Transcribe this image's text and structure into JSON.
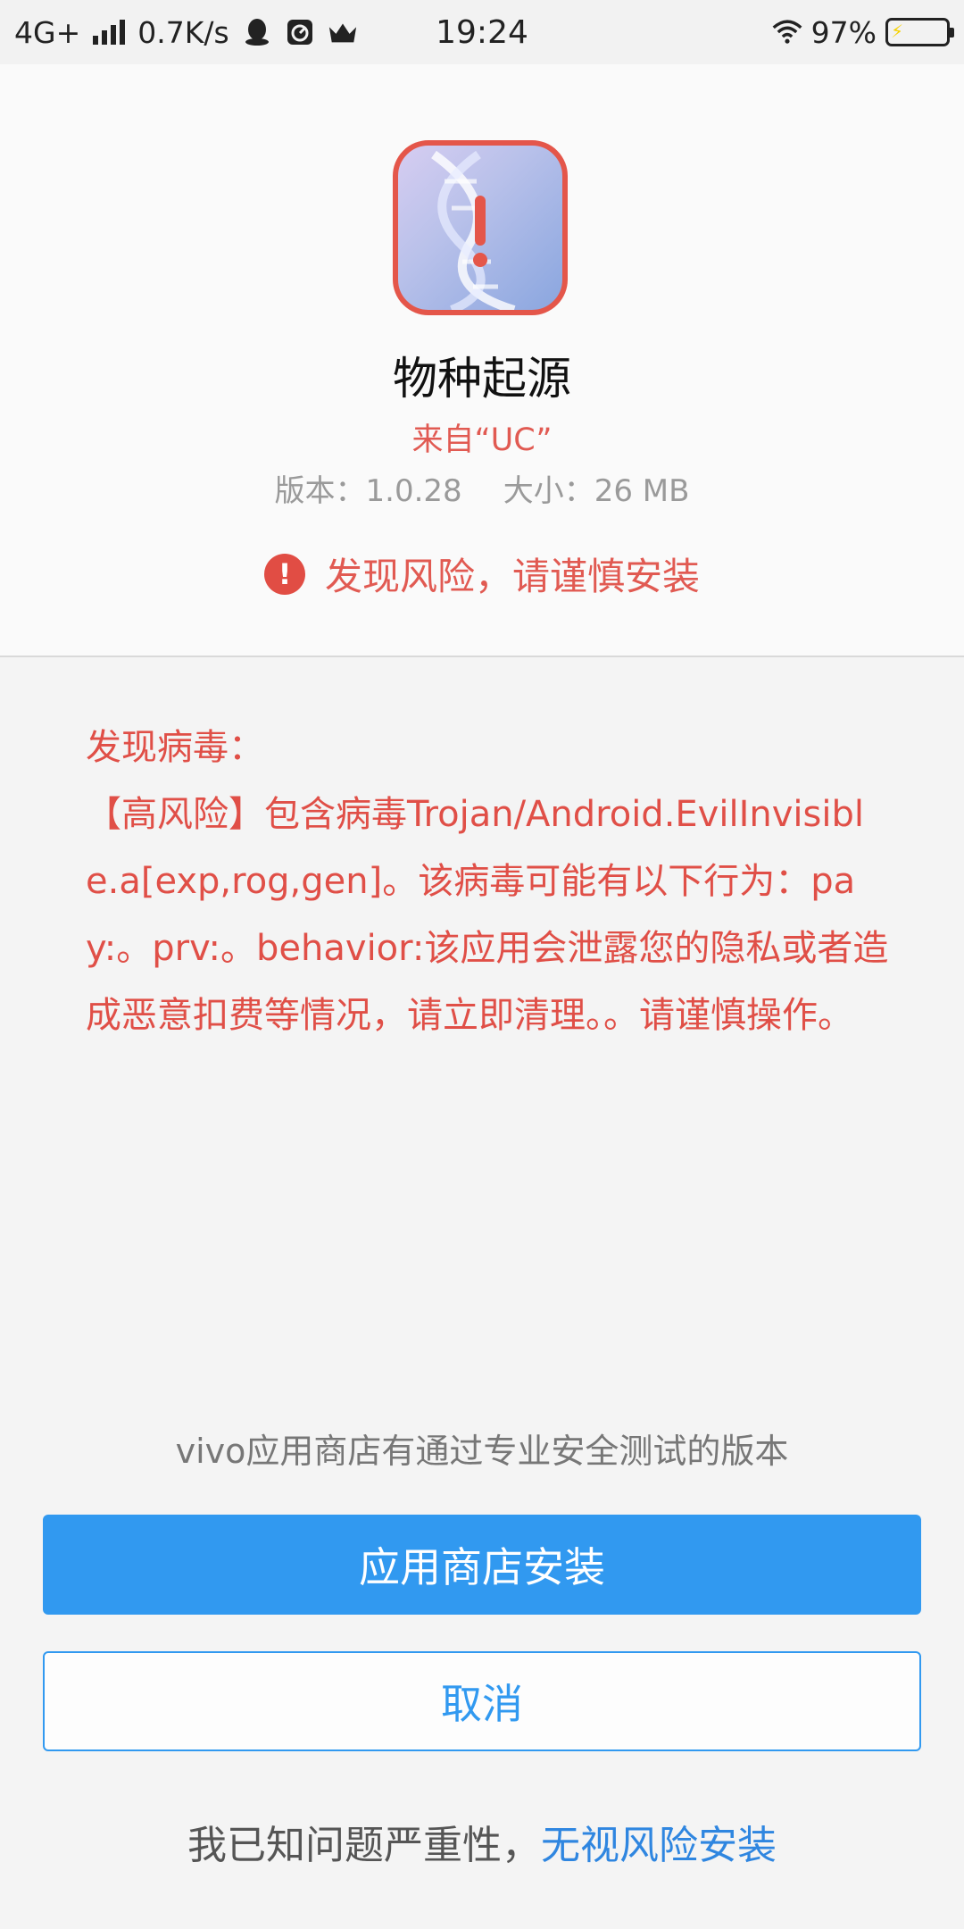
{
  "status_bar": {
    "network": "4G+",
    "speed": "0.7K/s",
    "time": "19:24",
    "battery": "97%",
    "icons": [
      "signal-icon",
      "qq-icon",
      "speedometer-icon",
      "crown-icon",
      "wifi-icon",
      "battery-icon"
    ]
  },
  "app": {
    "name": "物种起源",
    "source": "来自“UC”",
    "version": "版本：1.0.28",
    "size": "大小：26 MB",
    "risk_text": "发现风险，请谨慎安装",
    "risk_icon": "!"
  },
  "warning": {
    "heading": "发现病毒：",
    "body": "【高风险】包含病毒Trojan/Android.EvilInvisible.a[exp,rog,gen]。该病毒可能有以下行为：pay:。prv:。behavior:该应用会泄露您的隐私或者造成恶意扣费等情况，请立即清理。。请谨慎操作。"
  },
  "actions": {
    "store_hint": "vivo应用商店有通过专业安全测试的版本",
    "store_install": "应用商店安装",
    "cancel": "取消",
    "ignore_prefix": "我已知问题严重性，",
    "ignore_link": "无视风险安装"
  },
  "colors": {
    "primary_blue": "#3199f0",
    "risk_red": "#e15a52",
    "link_blue": "#2f86e0"
  }
}
